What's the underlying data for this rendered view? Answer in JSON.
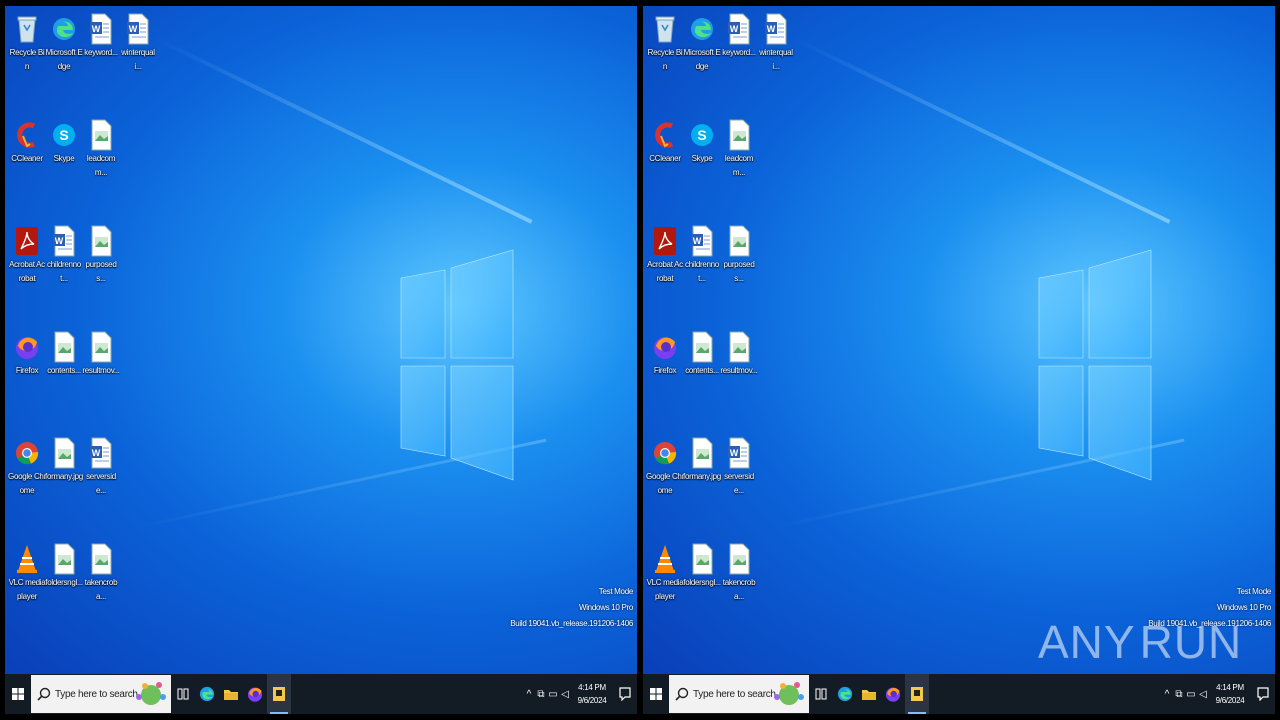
{
  "panes": [
    {
      "id": "left",
      "icons": [
        {
          "label": "Recycle Bin",
          "type": "recycle",
          "col": 0,
          "row": 0
        },
        {
          "label": "Microsoft Edge",
          "type": "edge",
          "col": 1,
          "row": 0
        },
        {
          "label": "keyword...",
          "type": "word",
          "col": 2,
          "row": 0
        },
        {
          "label": "winterquali...",
          "type": "word",
          "col": 3,
          "row": 0
        },
        {
          "label": "CCleaner",
          "type": "ccleaner",
          "col": 0,
          "row": 1
        },
        {
          "label": "Skype",
          "type": "skype",
          "col": 1,
          "row": 1
        },
        {
          "label": "leadcomm...",
          "type": "image",
          "col": 2,
          "row": 1
        },
        {
          "label": "Acrobat Acrobat",
          "type": "acrobat",
          "col": 0,
          "row": 2
        },
        {
          "label": "childrennot...",
          "type": "word",
          "col": 1,
          "row": 2
        },
        {
          "label": "purposeds...",
          "type": "image",
          "col": 2,
          "row": 2
        },
        {
          "label": "Firefox",
          "type": "firefox",
          "col": 0,
          "row": 3
        },
        {
          "label": "contents...",
          "type": "image",
          "col": 1,
          "row": 3
        },
        {
          "label": "resultmov...",
          "type": "image",
          "col": 2,
          "row": 3
        },
        {
          "label": "Google Chrome",
          "type": "chrome",
          "col": 0,
          "row": 4
        },
        {
          "label": "formany.jpg",
          "type": "image",
          "col": 1,
          "row": 4
        },
        {
          "label": "serverside...",
          "type": "word",
          "col": 2,
          "row": 4
        },
        {
          "label": "VLC media player",
          "type": "vlc",
          "col": 0,
          "row": 5
        },
        {
          "label": "foldersngl...",
          "type": "image",
          "col": 1,
          "row": 5
        },
        {
          "label": "takencroba...",
          "type": "image",
          "col": 2,
          "row": 5
        }
      ],
      "watermark": [
        "Test Mode",
        "Windows 10 Pro",
        "Build 19041.vb_release.191206-1406"
      ],
      "search_placeholder": "Type here to search",
      "clock": {
        "time": "4:14 PM",
        "date": "9/6/2024"
      }
    },
    {
      "id": "right",
      "icons": [
        {
          "label": "Recycle Bin",
          "type": "recycle",
          "col": 0,
          "row": 0
        },
        {
          "label": "Microsoft Edge",
          "type": "edge",
          "col": 1,
          "row": 0
        },
        {
          "label": "keyword...",
          "type": "word",
          "col": 2,
          "row": 0
        },
        {
          "label": "winterquali...",
          "type": "word",
          "col": 3,
          "row": 0
        },
        {
          "label": "CCleaner",
          "type": "ccleaner",
          "col": 0,
          "row": 1
        },
        {
          "label": "Skype",
          "type": "skype",
          "col": 1,
          "row": 1
        },
        {
          "label": "leadcomm...",
          "type": "image",
          "col": 2,
          "row": 1
        },
        {
          "label": "Acrobat Acrobat",
          "type": "acrobat",
          "col": 0,
          "row": 2
        },
        {
          "label": "childrennot...",
          "type": "word",
          "col": 1,
          "row": 2
        },
        {
          "label": "purposeds...",
          "type": "image",
          "col": 2,
          "row": 2
        },
        {
          "label": "Firefox",
          "type": "firefox",
          "col": 0,
          "row": 3
        },
        {
          "label": "contents...",
          "type": "image",
          "col": 1,
          "row": 3
        },
        {
          "label": "resultmov...",
          "type": "image",
          "col": 2,
          "row": 3
        },
        {
          "label": "Google Chrome",
          "type": "chrome",
          "col": 0,
          "row": 4
        },
        {
          "label": "formany.jpg",
          "type": "image",
          "col": 1,
          "row": 4
        },
        {
          "label": "serverside...",
          "type": "word",
          "col": 2,
          "row": 4
        },
        {
          "label": "VLC media player",
          "type": "vlc",
          "col": 0,
          "row": 5
        },
        {
          "label": "foldersngl...",
          "type": "image",
          "col": 1,
          "row": 5
        },
        {
          "label": "takencroba...",
          "type": "image",
          "col": 2,
          "row": 5
        }
      ],
      "watermark": [
        "Test Mode",
        "Windows 10 Pro",
        "Build 19041.vb_release.191206-1406"
      ],
      "search_placeholder": "Type here to search",
      "clock": {
        "time": "4:14 PM",
        "date": "9/6/2024"
      }
    }
  ],
  "taskbar_apps": [
    "task-view-icon",
    "edge-icon",
    "file-explorer-icon",
    "firefox-icon",
    "sandbox-app-icon"
  ],
  "brand": {
    "left": "ANY",
    "right": "RUN"
  },
  "colors": {
    "taskbar": "#131b24",
    "desktop_accent": "#1b8ff0",
    "watermark": "#ffffff"
  }
}
